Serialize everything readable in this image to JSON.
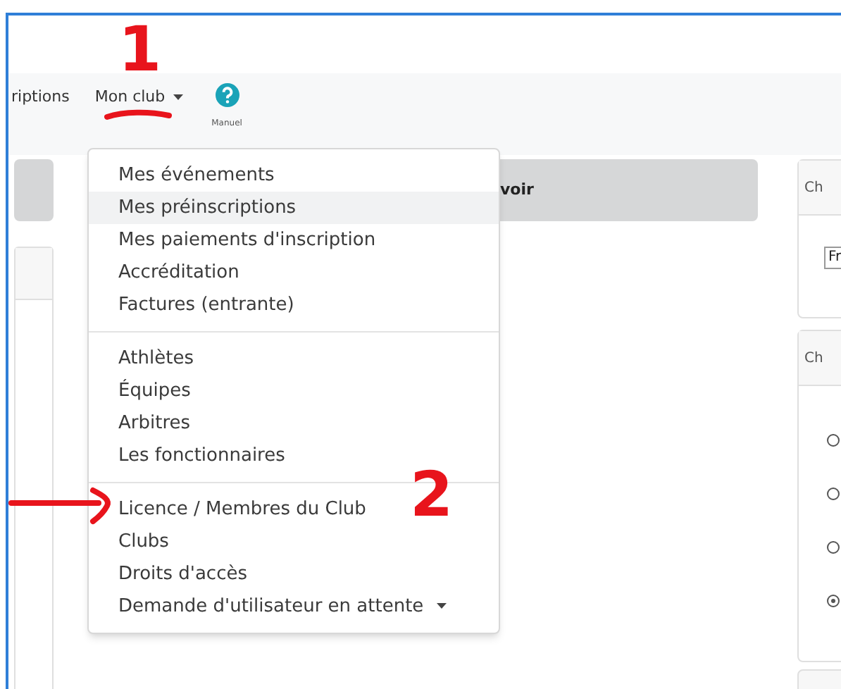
{
  "nav": {
    "items": [
      {
        "label": "riptions",
        "caret": false
      },
      {
        "label": "Mon club",
        "caret": true
      }
    ],
    "help": {
      "label": "Manuel"
    }
  },
  "main": {
    "banner": {
      "label": "voir"
    }
  },
  "right_cards": [
    {
      "kind": "select",
      "header": "Ch",
      "value": "Fr"
    },
    {
      "kind": "radios",
      "header": "Ch",
      "radios": [
        {
          "selected": false
        },
        {
          "selected": false
        },
        {
          "selected": false
        },
        {
          "selected": true
        }
      ]
    }
  ],
  "dropdown": {
    "groups": [
      {
        "items": [
          {
            "label": "Mes événements",
            "highlighted": false,
            "caret": false
          },
          {
            "label": "Mes préinscriptions",
            "highlighted": true,
            "caret": false
          },
          {
            "label": "Mes paiements d'inscription",
            "highlighted": false,
            "caret": false
          },
          {
            "label": "Accréditation",
            "highlighted": false,
            "caret": false
          },
          {
            "label": "Factures (entrante)",
            "highlighted": false,
            "caret": false
          }
        ]
      },
      {
        "items": [
          {
            "label": "Athlètes",
            "highlighted": false,
            "caret": false
          },
          {
            "label": "Équipes",
            "highlighted": false,
            "caret": false
          },
          {
            "label": "Arbitres",
            "highlighted": false,
            "caret": false
          },
          {
            "label": "Les fonctionnaires",
            "highlighted": false,
            "caret": false
          }
        ]
      },
      {
        "items": [
          {
            "label": "Licence / Membres du Club",
            "highlighted": false,
            "caret": false
          },
          {
            "label": "Clubs",
            "highlighted": false,
            "caret": false
          },
          {
            "label": "Droits d'accès",
            "highlighted": false,
            "caret": false
          },
          {
            "label": "Demande d'utilisateur en attente",
            "highlighted": false,
            "caret": true
          }
        ]
      }
    ]
  },
  "annotations": [
    {
      "kind": "number",
      "text": "1"
    },
    {
      "kind": "underline"
    },
    {
      "kind": "arrow"
    },
    {
      "kind": "number",
      "text": "2"
    }
  ]
}
